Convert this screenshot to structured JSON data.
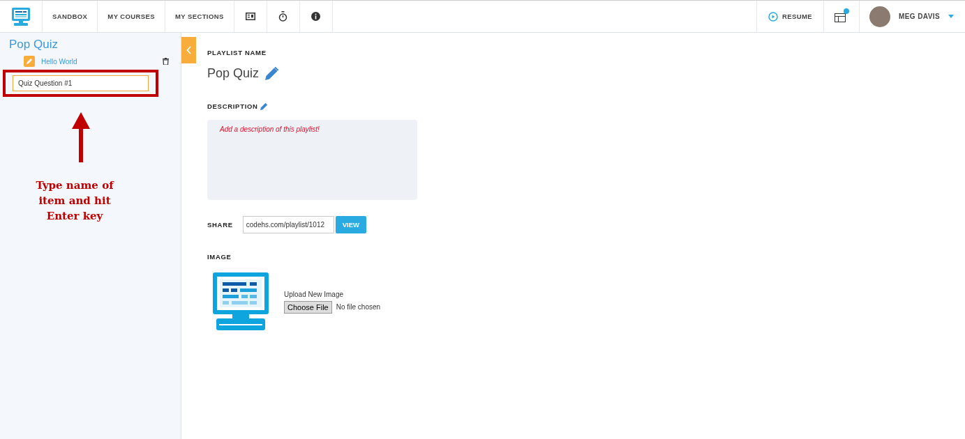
{
  "nav": {
    "links": [
      {
        "kind": "text",
        "label": "SANDBOX"
      },
      {
        "kind": "text",
        "label": "MY COURSES"
      },
      {
        "kind": "text",
        "label": "MY SECTIONS"
      },
      {
        "kind": "card"
      },
      {
        "kind": "stopwatch"
      },
      {
        "kind": "info"
      }
    ],
    "resume": "RESUME",
    "notification": true,
    "user": "MEG DAVIS"
  },
  "sidebar": {
    "title": "Pop Quiz",
    "items": [
      {
        "label": "Hello World"
      }
    ],
    "new_item_value": "Quiz Question #1",
    "annotation": "Type name of item and hit Enter key"
  },
  "main": {
    "playlist_name_label": "PLAYLIST NAME",
    "playlist_name": "Pop Quiz",
    "description_label": "DESCRIPTION",
    "description_placeholder": "Add a description of this playlist!",
    "share_label": "SHARE",
    "share_url": "codehs.com/playlist/1012",
    "view_button": "VIEW",
    "image_label": "IMAGE",
    "upload_label": "Upload New Image",
    "choose_file": "Choose File",
    "no_file": "No file chosen"
  }
}
